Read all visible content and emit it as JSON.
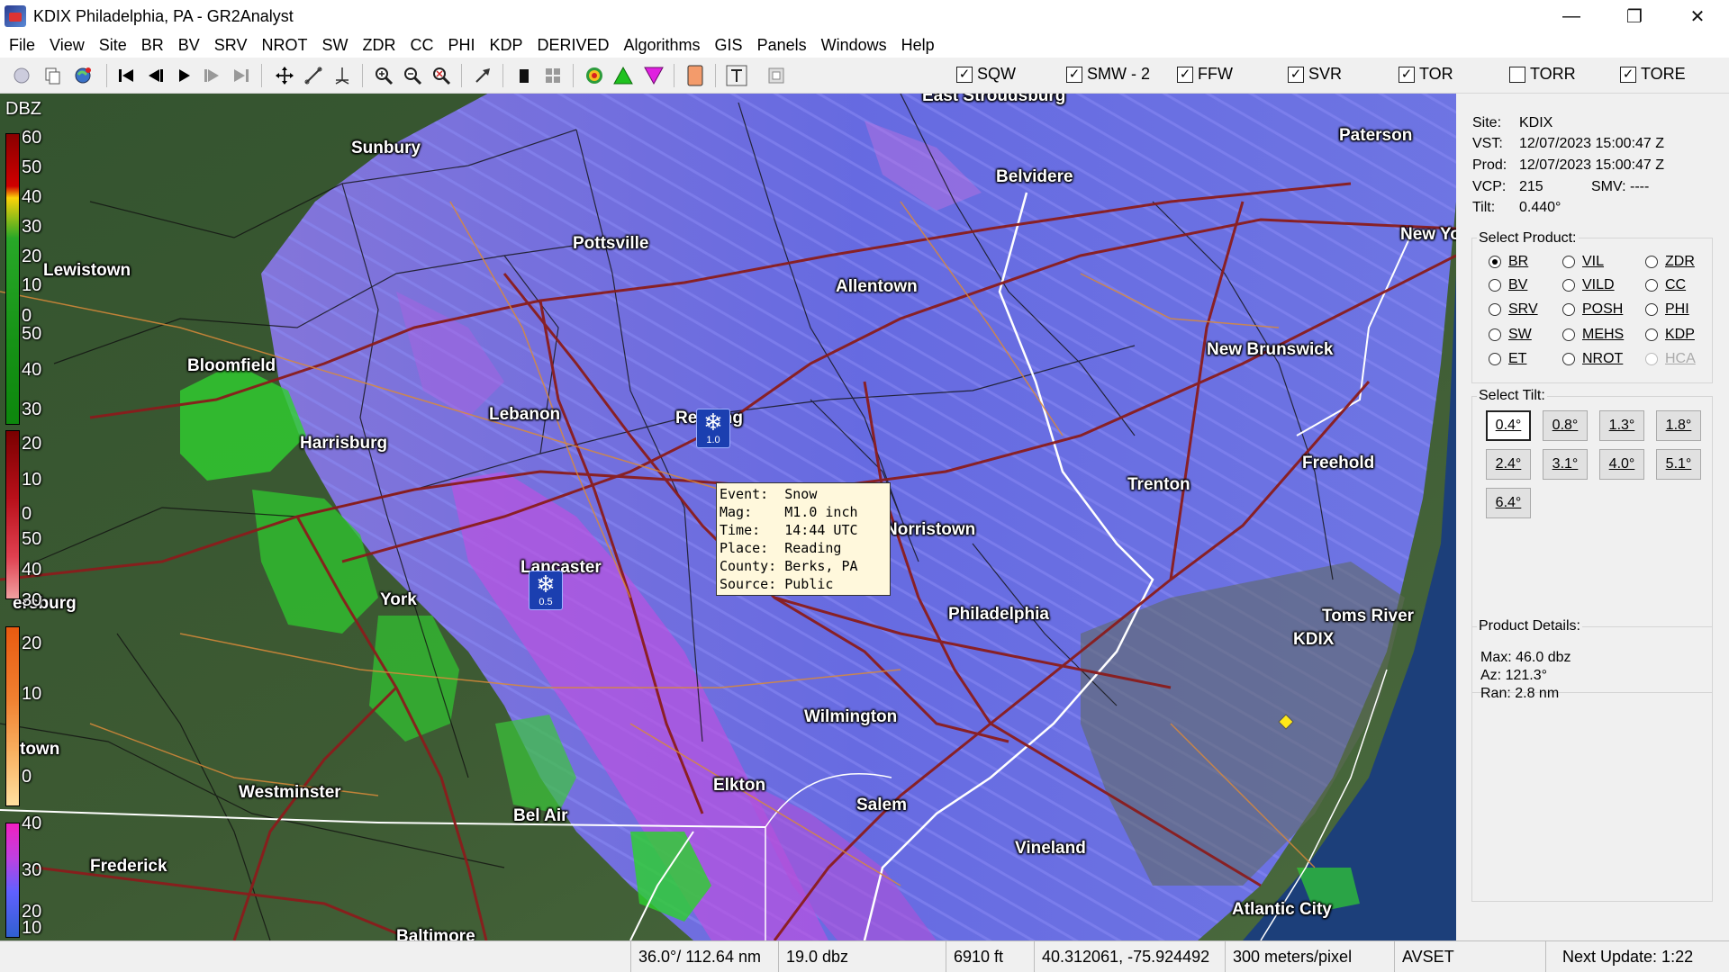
{
  "window": {
    "title": "KDIX Philadelphia, PA - GR2Analyst"
  },
  "menu": [
    "File",
    "View",
    "Site",
    "BR",
    "BV",
    "SRV",
    "NROT",
    "SW",
    "ZDR",
    "CC",
    "PHI",
    "KDP",
    "DERIVED",
    "Algorithms",
    "GIS",
    "Panels",
    "Windows",
    "Help"
  ],
  "toolbar_icons": [
    "globe-icon",
    "copy-icon",
    "globe-refresh-icon",
    "skip-first-icon",
    "step-back-icon",
    "play-icon",
    "step-forward-icon",
    "skip-last-icon",
    "pan-icon",
    "measure-icon",
    "crosshair-icon",
    "zoom-in-icon",
    "zoom-out-icon",
    "zoom-reset-icon",
    "arrow-icon",
    "stop-icon",
    "grid-icon",
    "storm-tracks-icon",
    "meso-up-icon",
    "meso-down-icon",
    "color-palette-icon",
    "text-tool-icon",
    "frame-icon"
  ],
  "warnings": [
    {
      "label": "SQW",
      "checked": true
    },
    {
      "label": "SMW - 2",
      "checked": true
    },
    {
      "label": "FFW",
      "checked": true
    },
    {
      "label": "SVR",
      "checked": true
    },
    {
      "label": "TOR",
      "checked": true
    },
    {
      "label": "TORR",
      "checked": false
    },
    {
      "label": "TORE",
      "checked": true
    }
  ],
  "legend": {
    "unit": "DBZ",
    "scales": [
      {
        "labels": [
          "60",
          "50",
          "40",
          "30",
          "20",
          "10",
          "0"
        ]
      },
      {
        "labels": [
          "50",
          "40",
          "30",
          "20",
          "10",
          "0"
        ]
      },
      {
        "labels": [
          "50",
          "40",
          "30",
          "20",
          "10",
          "0"
        ]
      },
      {
        "labels": [
          "40",
          "30",
          "20",
          "10",
          "0"
        ]
      }
    ]
  },
  "cities": {
    "sunbury": "Sunbury",
    "lewistown": "Lewistown",
    "bloomfield": "Bloomfield",
    "harrisburg": "Harrisburg",
    "pottsville": "Pottsville",
    "lebanon": "Lebanon",
    "allentown": "Allentown",
    "belvidere": "Belvidere",
    "east_stroudsburg": "East Stroudsburg",
    "paterson": "Paterson",
    "new_york": "New Yo",
    "new_brunswick": "New Brunswick",
    "reading": "Reading",
    "norristown": "Norristown",
    "trenton": "Trenton",
    "freehold": "Freehold",
    "lancaster": "Lancaster",
    "york": "York",
    "chambersburg": "ersburg",
    "philadelphia": "Philadelphia",
    "toms_river": "Toms River",
    "kdix": "KDIX",
    "wilmington": "Wilmington",
    "hagerstown": "town",
    "westminster": "Westminster",
    "elkton": "Elkton",
    "salem": "Salem",
    "bel_air": "Bel Air",
    "vineland": "Vineland",
    "frederick": "Frederick",
    "atlantic_city": "Atlantic City",
    "baltimore": "Baltimore"
  },
  "lsr_icons": [
    {
      "name": "Reading",
      "mag": "1.0"
    },
    {
      "name": "Lancaster",
      "mag": "0.5"
    }
  ],
  "popup": {
    "lines": [
      "Event:  Snow",
      "Mag:    M1.0 inch",
      "Time:   14:44 UTC",
      "Place:  Reading",
      "County: Berks, PA",
      "Source: Public"
    ]
  },
  "panel": {
    "site_label": "Site:",
    "site": "KDIX",
    "vst_label": "VST:",
    "vst": "12/07/2023  15:00:47 Z",
    "prod_label": "Prod:",
    "prod": "12/07/2023  15:00:47 Z",
    "vcp_label": "VCP:",
    "vcp": "215",
    "smv_label": "SMV:",
    "smv": "----",
    "tilt_label": "Tilt:",
    "tilt": "0.440°",
    "select_product_title": "Select Product:",
    "products": [
      {
        "label": "BR",
        "checked": true,
        "enabled": true
      },
      {
        "label": "VIL",
        "checked": false,
        "enabled": true
      },
      {
        "label": "ZDR",
        "checked": false,
        "enabled": true
      },
      {
        "label": "BV",
        "checked": false,
        "enabled": true
      },
      {
        "label": "VILD",
        "checked": false,
        "enabled": true
      },
      {
        "label": "CC",
        "checked": false,
        "enabled": true
      },
      {
        "label": "SRV",
        "checked": false,
        "enabled": true
      },
      {
        "label": "POSH",
        "checked": false,
        "enabled": true
      },
      {
        "label": "PHI",
        "checked": false,
        "enabled": true
      },
      {
        "label": "SW",
        "checked": false,
        "enabled": true
      },
      {
        "label": "MEHS",
        "checked": false,
        "enabled": true
      },
      {
        "label": "KDP",
        "checked": false,
        "enabled": true
      },
      {
        "label": "ET",
        "checked": false,
        "enabled": true
      },
      {
        "label": "NROT",
        "checked": false,
        "enabled": true
      },
      {
        "label": "HCA",
        "checked": false,
        "enabled": false
      }
    ],
    "select_tilt_title": "Select Tilt:",
    "tilts": [
      "0.4°",
      "0.8°",
      "1.3°",
      "1.8°",
      "2.4°",
      "3.1°",
      "4.0°",
      "5.1°",
      "6.4°"
    ],
    "active_tilt": "0.4°",
    "product_details_title": "Product Details:",
    "details": {
      "max": "Max:  46.0 dbz",
      "az": "Az:   121.3°",
      "ran": "Ran:  2.8 nm"
    }
  },
  "status": {
    "azran": "36.0°/ 112.64 nm",
    "value": "19.0 dbz",
    "height": "6910 ft",
    "latlon": "40.312061, -75.924492",
    "resolution": "300 meters/pixel",
    "mode": "AVSET",
    "next_update": "Next Update: 1:22"
  },
  "colors": {
    "accent": "#1b3fb0",
    "map_land": "#2d4a2c",
    "ocean": "#1c3f7a",
    "reflectivity": "#6a6cf0"
  }
}
